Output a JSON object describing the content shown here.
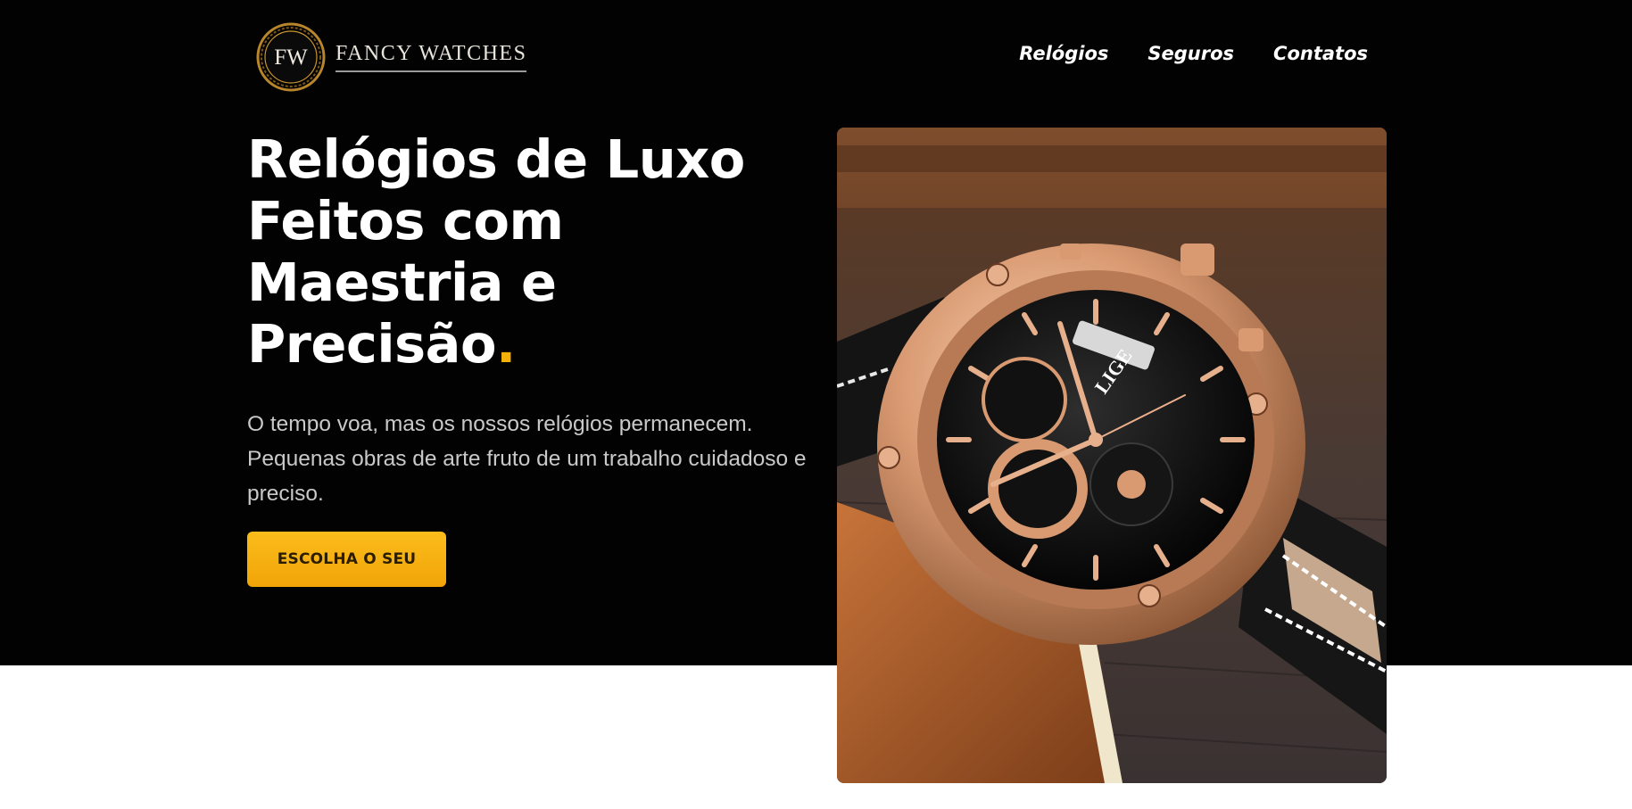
{
  "brand": {
    "monogram": "FW",
    "name": "FANCY WATCHES"
  },
  "nav": {
    "items": [
      {
        "label": "Relógios"
      },
      {
        "label": "Seguros"
      },
      {
        "label": "Contatos"
      }
    ]
  },
  "hero": {
    "title": "Relógios de Luxo Feitos com Maestria e Precisão",
    "title_accent": ".",
    "subtitle": "O tempo voa, mas os nossos relógios permanecem. Pequenas obras de arte fruto de um trabalho cuidadoso e preciso.",
    "cta_label": "ESCOLHA O SEU"
  },
  "product": {
    "dial_brand": "LIGE",
    "image_description_icon": "rose-gold-chronograph-watch"
  },
  "colors": {
    "background": "#020202",
    "accent": "#f5b10a",
    "text": "#ffffff",
    "muted_text": "#c9c9c9",
    "watch_case": "#d99a72"
  }
}
